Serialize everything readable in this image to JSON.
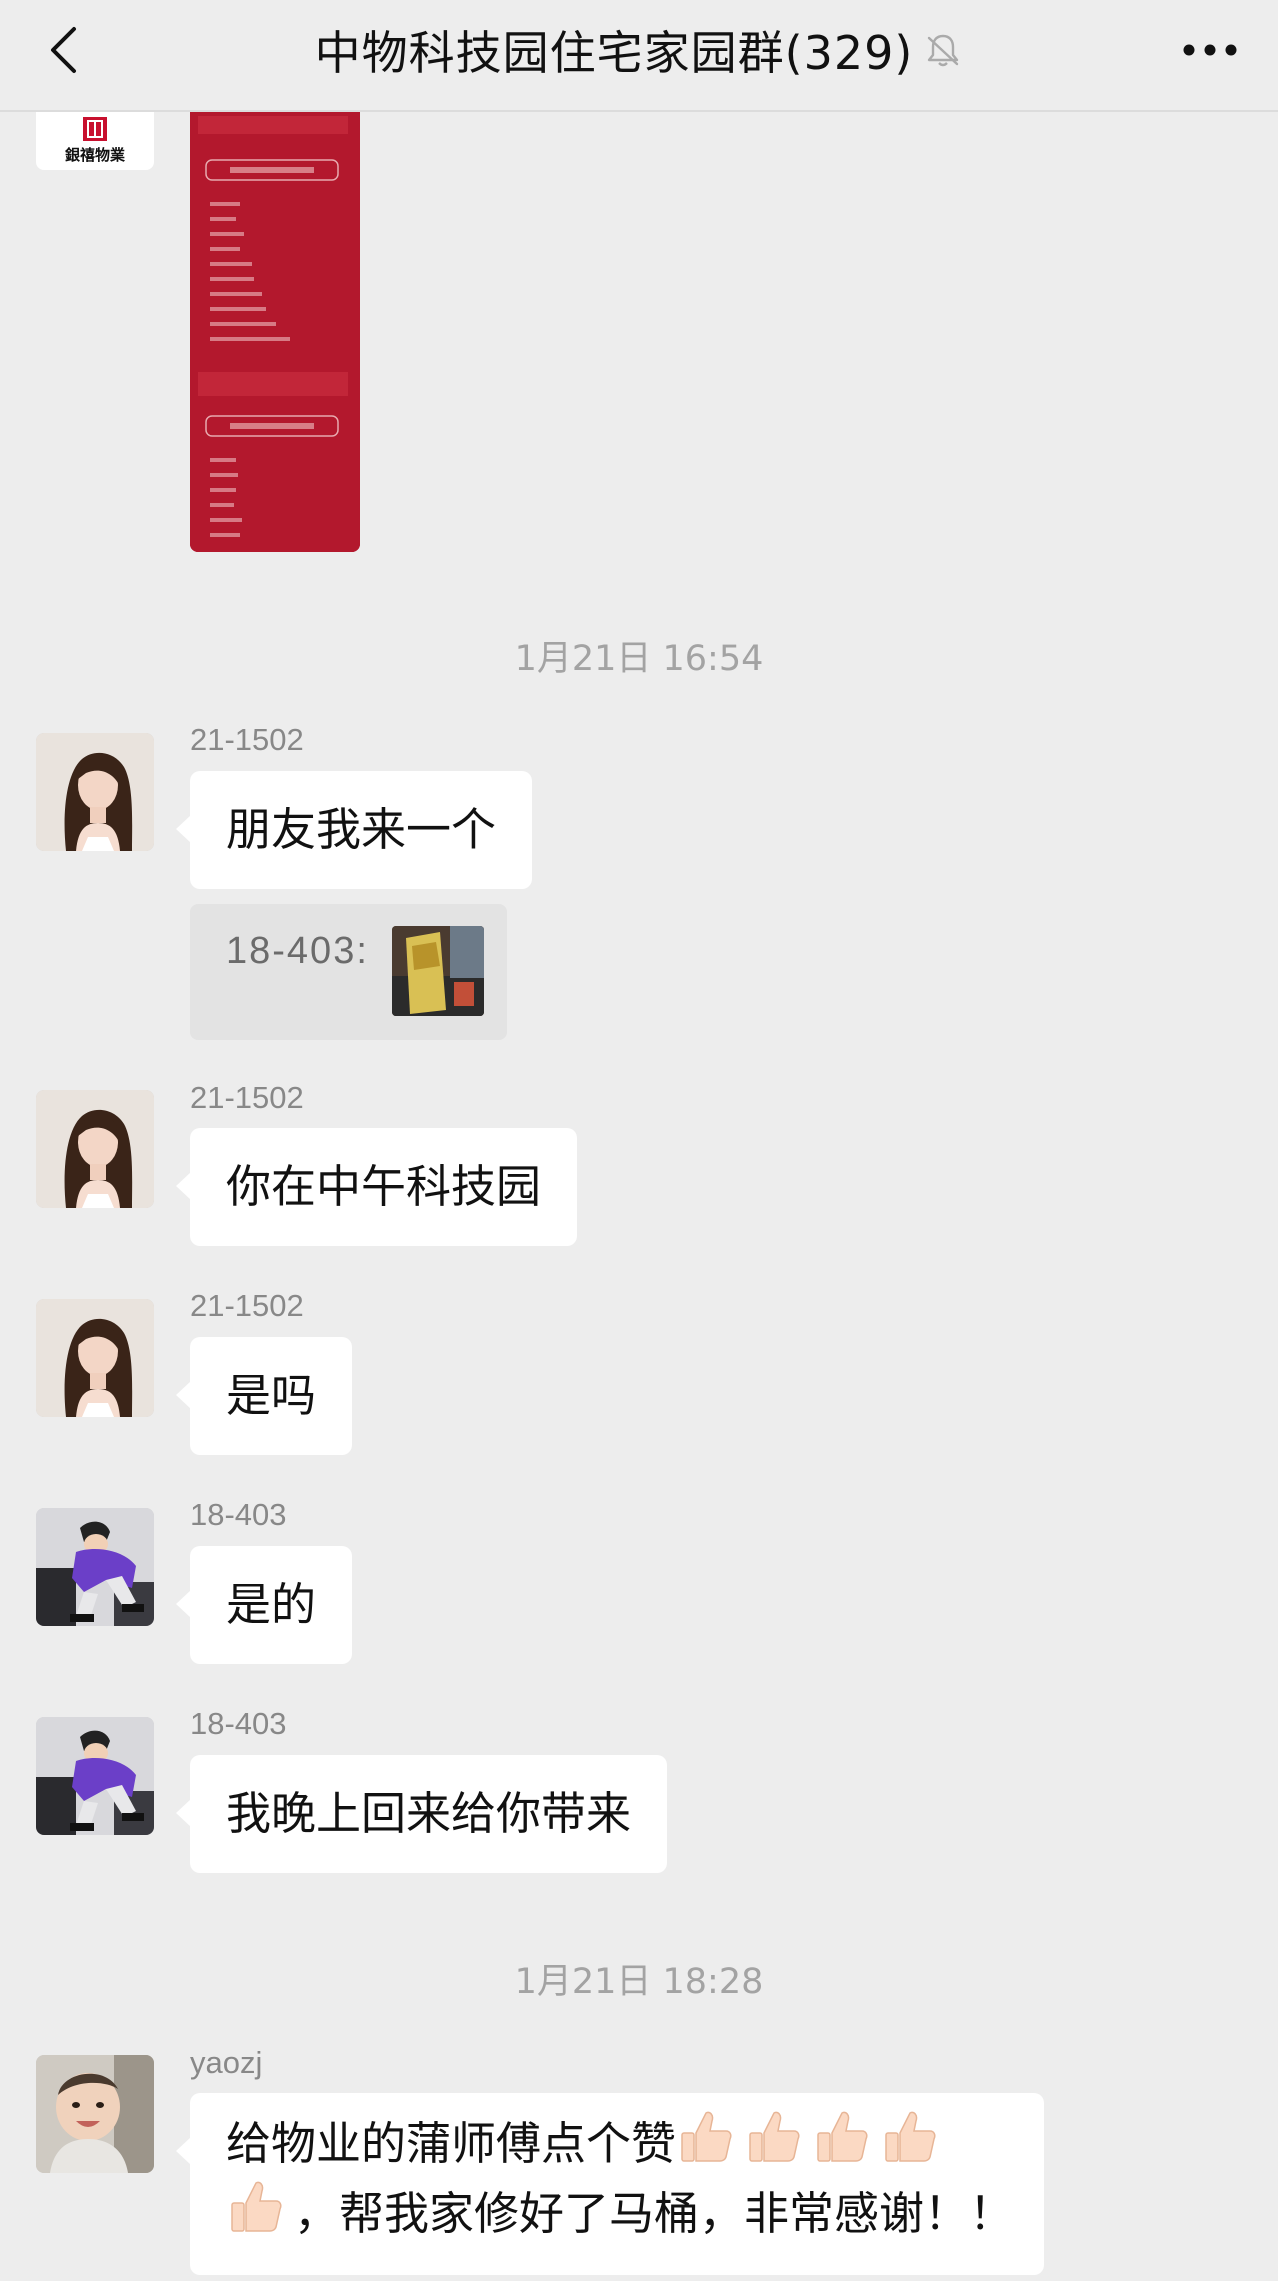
{
  "header": {
    "title": "中物科技园住宅家园群(329)"
  },
  "timestamps": [
    "1月21日 16:54",
    "1月21日 18:28"
  ],
  "messages": [
    {
      "sender": "21-1502",
      "text": "朋友我来一个"
    },
    {
      "quote": "18-403:"
    },
    {
      "sender": "21-1502",
      "text": "你在中午科技园"
    },
    {
      "sender": "21-1502",
      "text": "是吗"
    },
    {
      "sender": "18-403",
      "text": "是的"
    },
    {
      "sender": "18-403",
      "text": "我晚上回来给你带来"
    },
    {
      "sender": "yaozj",
      "text_line2": "，帮我家修好了马桶，非常感谢！！",
      "text_line1": "给物业的蒲师傅点个赞"
    }
  ],
  "logo_text": "銀禧物業",
  "colors": {
    "background": "#ededed",
    "bubble": "#ffffff",
    "poster_red": "#b3182d",
    "timestamp": "#a3a3a3"
  },
  "icons": [
    "back-arrow-icon",
    "mute-bell-icon",
    "more-dots-icon",
    "thumbs-up-icon"
  ]
}
